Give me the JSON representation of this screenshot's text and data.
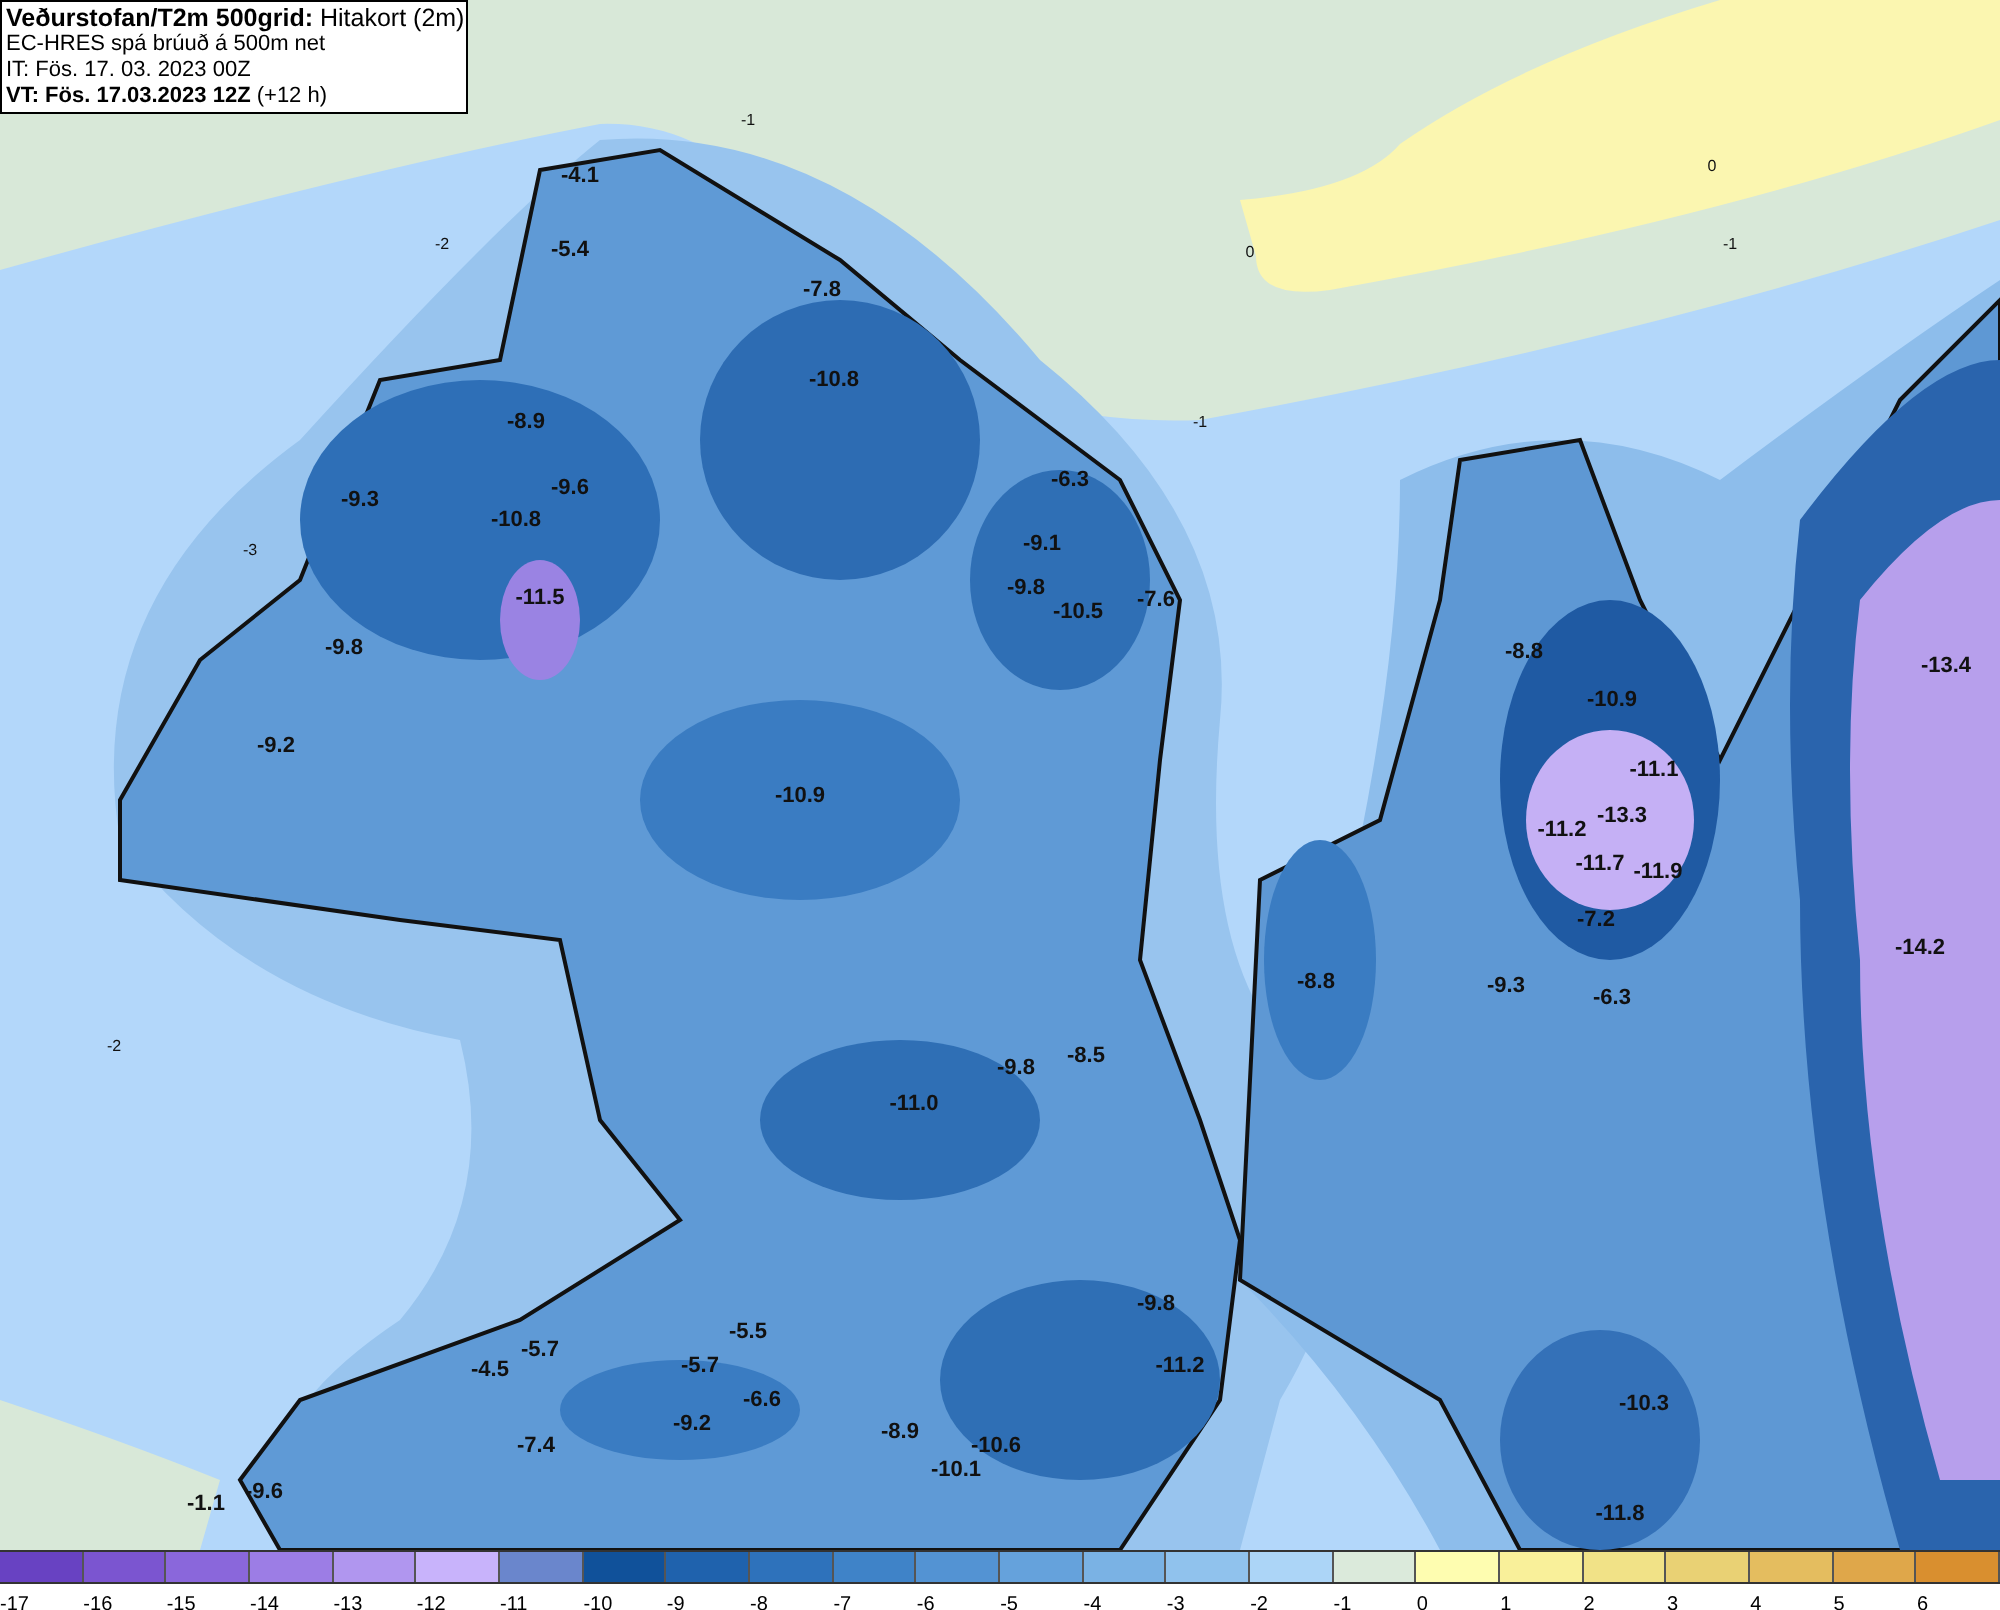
{
  "header": {
    "lines": [
      "**Veðurstofan/T2m 500grid:** Hitakort (2m)",
      "EC-HRES spá brúuð á 500m net",
      "IT: Fös. 17. 03. 2023 00Z",
      "**VT: Fös. 17.03.2023 12Z** (+12 h)"
    ]
  },
  "map": {
    "labels": [
      {
        "text": "-4.1",
        "kind": "value"
      },
      {
        "text": "-5.4",
        "kind": "value"
      },
      {
        "text": "-7.8",
        "kind": "value"
      },
      {
        "text": "-10.8",
        "kind": "value"
      },
      {
        "text": "-8.9",
        "kind": "value"
      },
      {
        "text": "-9.3",
        "kind": "value"
      },
      {
        "text": "-9.6",
        "kind": "value"
      },
      {
        "text": "-10.8",
        "kind": "value"
      },
      {
        "text": "-11.5",
        "kind": "value"
      },
      {
        "text": "-9.8",
        "kind": "value"
      },
      {
        "text": "-9.2",
        "kind": "value"
      },
      {
        "text": "-10.9",
        "kind": "value"
      },
      {
        "text": "-6.3",
        "kind": "value"
      },
      {
        "text": "-9.1",
        "kind": "value"
      },
      {
        "text": "-9.8",
        "kind": "value"
      },
      {
        "text": "-10.5",
        "kind": "value"
      },
      {
        "text": "-7.6",
        "kind": "value"
      },
      {
        "text": "-8.8",
        "kind": "value"
      },
      {
        "text": "-9.8",
        "kind": "value"
      },
      {
        "text": "-8.5",
        "kind": "value"
      },
      {
        "text": "-11.0",
        "kind": "value"
      },
      {
        "text": "-5.5",
        "kind": "value"
      },
      {
        "text": "-4.5",
        "kind": "value"
      },
      {
        "text": "-5.7",
        "kind": "value"
      },
      {
        "text": "-5.7",
        "kind": "value"
      },
      {
        "text": "-6.6",
        "kind": "value"
      },
      {
        "text": "-7.4",
        "kind": "value"
      },
      {
        "text": "-9.2",
        "kind": "value"
      },
      {
        "text": "-9.6",
        "kind": "value"
      },
      {
        "text": "-1.1",
        "kind": "value"
      },
      {
        "text": "-8.9",
        "kind": "value"
      },
      {
        "text": "-10.6",
        "kind": "value"
      },
      {
        "text": "-10.1",
        "kind": "value"
      },
      {
        "text": "-9.8",
        "kind": "value"
      },
      {
        "text": "-11.2",
        "kind": "value"
      },
      {
        "text": "-8.8",
        "kind": "value"
      },
      {
        "text": "-10.9",
        "kind": "value"
      },
      {
        "text": "-11.1",
        "kind": "value"
      },
      {
        "text": "-13.3",
        "kind": "value"
      },
      {
        "text": "-11.2",
        "kind": "value"
      },
      {
        "text": "-11.7",
        "kind": "value"
      },
      {
        "text": "-11.9",
        "kind": "value"
      },
      {
        "text": "-7.2",
        "kind": "value"
      },
      {
        "text": "-9.3",
        "kind": "value"
      },
      {
        "text": "-6.3",
        "kind": "value"
      },
      {
        "text": "-13.4",
        "kind": "value"
      },
      {
        "text": "-14.2",
        "kind": "value"
      },
      {
        "text": "-10.3",
        "kind": "value"
      },
      {
        "text": "-11.8",
        "kind": "value"
      },
      {
        "text": "-1",
        "kind": "contour"
      },
      {
        "text": "0",
        "kind": "contour"
      },
      {
        "text": "-1",
        "kind": "contour"
      },
      {
        "text": "0",
        "kind": "contour"
      },
      {
        "text": "-1",
        "kind": "contour"
      },
      {
        "text": "-2",
        "kind": "contour"
      },
      {
        "text": "-3",
        "kind": "contour"
      },
      {
        "text": "-2",
        "kind": "contour"
      }
    ]
  },
  "legend": [
    {
      "label": "-17",
      "color": "#6842c2"
    },
    {
      "label": "-16",
      "color": "#7b55d0"
    },
    {
      "label": "-15",
      "color": "#8a67db"
    },
    {
      "label": "-14",
      "color": "#9c7de5"
    },
    {
      "label": "-13",
      "color": "#b096ef"
    },
    {
      "label": "-12",
      "color": "#c8b3fb"
    },
    {
      "label": "-11",
      "color": "#6a86cc"
    },
    {
      "label": "-10",
      "color": "#10519a"
    },
    {
      "label": "-9",
      "color": "#1f62ad"
    },
    {
      "label": "-8",
      "color": "#2e72bb"
    },
    {
      "label": "-7",
      "color": "#3f83c8"
    },
    {
      "label": "-6",
      "color": "#5393d3"
    },
    {
      "label": "-5",
      "color": "#65a2dc"
    },
    {
      "label": "-4",
      "color": "#7ab2e4"
    },
    {
      "label": "-3",
      "color": "#90c2ed"
    },
    {
      "label": "-2",
      "color": "#acd5f7"
    },
    {
      "label": "-1",
      "color": "#dbeadb"
    },
    {
      "label": "0",
      "color": "#fefdb0"
    },
    {
      "label": "1",
      "color": "#f9f09a"
    },
    {
      "label": "2",
      "color": "#f1e287"
    },
    {
      "label": "3",
      "color": "#e9d174"
    },
    {
      "label": "4",
      "color": "#e4bd5f"
    },
    {
      "label": "5",
      "color": "#dfa74a"
    },
    {
      "label": "6",
      "color": "#d98f2f"
    }
  ]
}
